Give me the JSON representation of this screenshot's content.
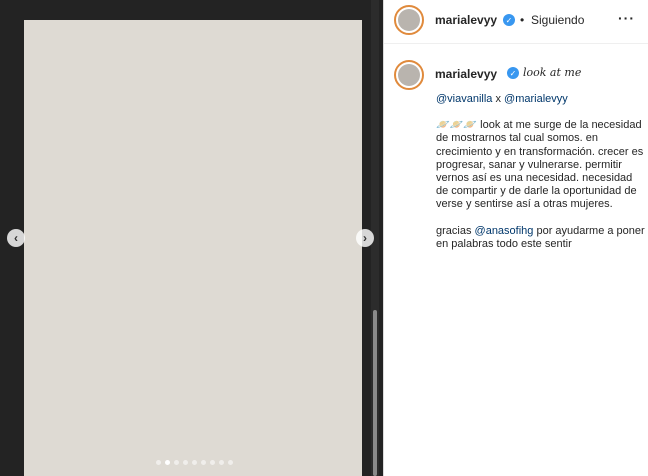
{
  "post": {
    "username": "marialevyy",
    "follow_status": "Siguiendo",
    "separator": "•",
    "more_label": "···",
    "verified_mark": "✓"
  },
  "media": {
    "image_description": "photo placeholder",
    "carousel_dots": 9,
    "active_dot": 1
  },
  "nav": {
    "prev": "‹",
    "next": "›"
  },
  "caption": {
    "username": "marialevyy",
    "title": "look at me",
    "mention1": "@viavanilla",
    "mention_sep": " x ",
    "mention2": "@marialevyy",
    "emoji": "🪐🪐🪐",
    "paragraph": "look at me surge de la necesidad de mostrarnos tal cual somos. en crecimiento y en transformación. crecer es progresar, sanar y vulnerarse. permitir vernos así es una necesidad. necesidad de compartir y de darle la oportunidad de verse y sentirse así a otras mujeres.",
    "thanks_prefix": "gracias ",
    "thanks_mention": "@anasofihg",
    "thanks_suffix": " por ayudarme a poner en palabras todo este sentir"
  },
  "colors": {
    "background": "#232323",
    "link": "#00376b",
    "verified": "#3897f0"
  }
}
